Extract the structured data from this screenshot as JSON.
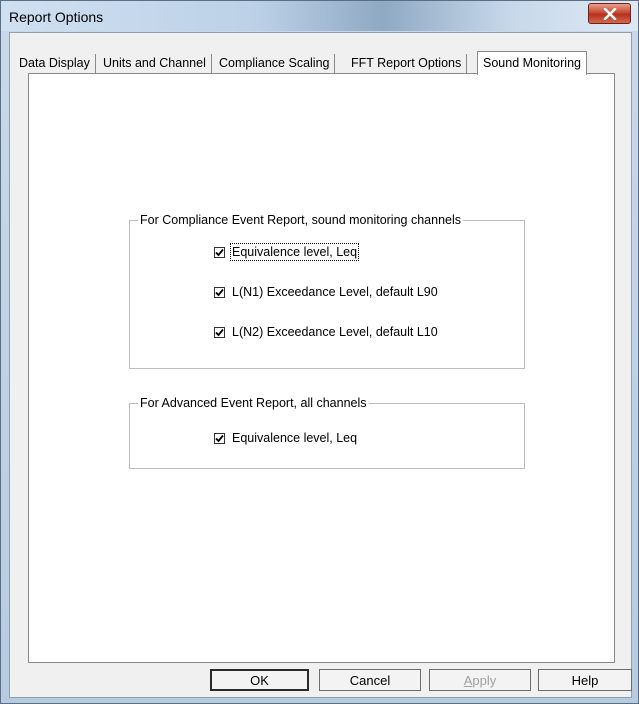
{
  "window": {
    "title": "Report Options",
    "close_icon": "close-x-icon"
  },
  "tabs": [
    {
      "label": "Data Display"
    },
    {
      "label": "Units and Channel"
    },
    {
      "label": "Compliance Scaling"
    },
    {
      "label": "FFT Report Options"
    },
    {
      "label": "Sound Monitoring",
      "active": true
    }
  ],
  "compliance_group": {
    "legend": "For Compliance Event Report, sound monitoring channels",
    "options": [
      {
        "label": "Equivalence level, Leq",
        "checked": true
      },
      {
        "label": "L(N1) Exceedance Level, default L90",
        "checked": true
      },
      {
        "label": "L(N2) Exceedance Level, default L10",
        "checked": true
      }
    ]
  },
  "advanced_group": {
    "legend": "For Advanced Event Report, all channels",
    "options": [
      {
        "label": "Equivalence level, Leq",
        "checked": true
      }
    ]
  },
  "buttons": {
    "ok": "OK",
    "cancel": "Cancel",
    "apply": "Apply",
    "help": "Help"
  }
}
